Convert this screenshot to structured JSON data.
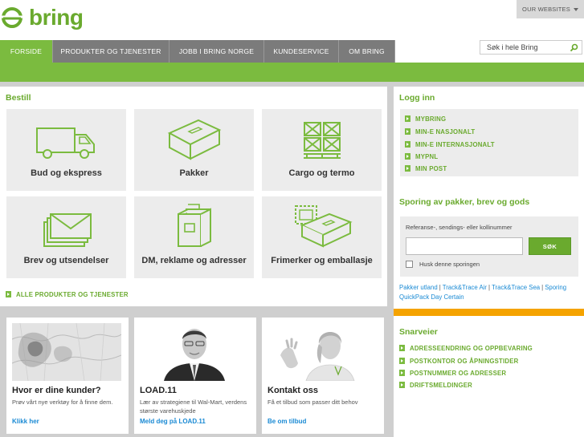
{
  "header": {
    "logo_text": "bring",
    "our_websites": "OUR WEBSITES",
    "search_placeholder": "Søk i hele Bring"
  },
  "nav": [
    {
      "label": "FORSIDE",
      "active": true
    },
    {
      "label": "PRODUKTER OG TJENESTER"
    },
    {
      "label": "JOBB I BRING NORGE"
    },
    {
      "label": "KUNDESERVICE"
    },
    {
      "label": "OM BRING"
    }
  ],
  "bestill": {
    "title": "Bestill",
    "tiles": [
      {
        "label": "Bud og ekspress",
        "icon": "van-icon"
      },
      {
        "label": "Pakker",
        "icon": "package-icon"
      },
      {
        "label": "Cargo og termo",
        "icon": "cargo-pallet-icon"
      },
      {
        "label": "Brev og utsendelser",
        "icon": "letters-icon"
      },
      {
        "label": "DM, reklame og adresser",
        "icon": "file-box-icon"
      },
      {
        "label": "Frimerker og emballasje",
        "icon": "stamp-box-icon"
      }
    ],
    "all_products_link": "ALLE PRODUKTER OG TJENESTER"
  },
  "promos": [
    {
      "title": "Hvor er dine kunder?",
      "desc": "Prøv vårt nye verktøy for å finne dem.",
      "link": "Klikk her"
    },
    {
      "title": "LOAD.11",
      "desc": "Lær av strategiene til Wal-Mart, verdens største varehuskjede",
      "link": "Meld deg på LOAD.11"
    },
    {
      "title": "Kontakt oss",
      "desc": "Få et tilbud som passer ditt behov",
      "link": "Be om tilbud"
    }
  ],
  "login": {
    "title": "Logg inn",
    "items": [
      "MYBRING",
      "MIN-E NASJONALT",
      "MIN-E INTERNASJONALT",
      "MYPNL",
      "MIN POST"
    ]
  },
  "sporing": {
    "title": "Sporing av pakker, brev og gods",
    "label": "Referanse-, sendings- eller kollinummer",
    "input_value": "",
    "button": "SØK",
    "remember": "Husk denne sporingen",
    "links": [
      "Pakker utland",
      "Track&Trace Air",
      "Track&Trace Sea",
      "Sporing QuickPack Day Certain"
    ]
  },
  "snarveier": {
    "title": "Snarveier",
    "items": [
      "ADRESSEENDRING OG OPPBEVARING",
      "POSTKONTOR OG ÅPNINGSTIDER",
      "POSTNUMMER OG ADRESSER",
      "DRIFTSMELDINGER"
    ]
  },
  "colors": {
    "brand_green": "#7bbb3f",
    "nav_gray": "#7b7b7b",
    "link_blue": "#1a8ad4",
    "accent_orange": "#f5a300"
  }
}
